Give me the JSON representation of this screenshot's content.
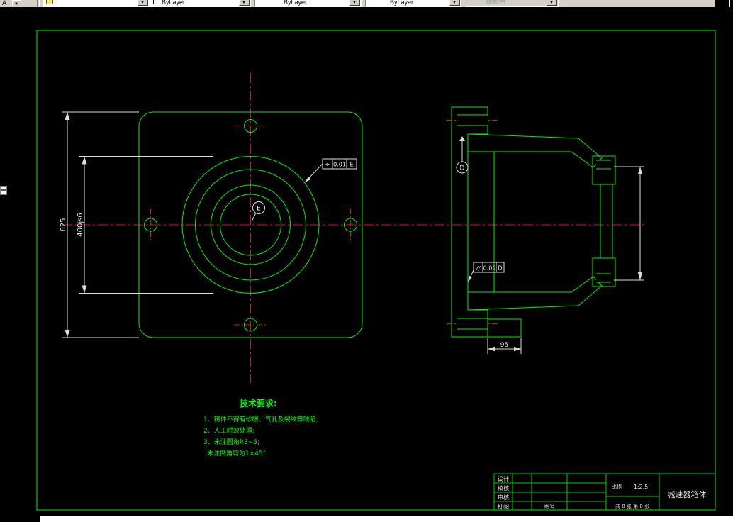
{
  "toolbar": {
    "fragment_label": "A",
    "color_value": "ByLayer",
    "linetype_value": "ByLayer",
    "lineweight_value": "ByLayer",
    "plotstyle_value": "随颜色"
  },
  "drawing": {
    "dim_height": "625",
    "dim_bore": "400js6",
    "dim_tab": "95",
    "datum_e": "E",
    "datum_d": "D",
    "fcf_position": {
      "symbol": "⌖",
      "tol": "0.01",
      "datum": "E"
    },
    "fcf_parallel": {
      "symbol": "//",
      "tol": "0.01",
      "datum": "D"
    },
    "tech": {
      "title": "技术要求:",
      "line1": "1、铸件不得有砂眼、气孔及裂纹等缺陷;",
      "line2": "2、人工时效处理;",
      "line3": "3、未注圆角R3~5;",
      "line4": "未注倒角均为1×45°"
    }
  },
  "title_block": {
    "row1": "设计",
    "row2": "校核",
    "row3": "审核",
    "row4": "批阅",
    "drawing_no_label": "图号",
    "scale_label": "比例",
    "scale_value": "1:2.5",
    "sheet_info": "共 8 张  第 8 张",
    "part_name": "减速器箱体"
  }
}
